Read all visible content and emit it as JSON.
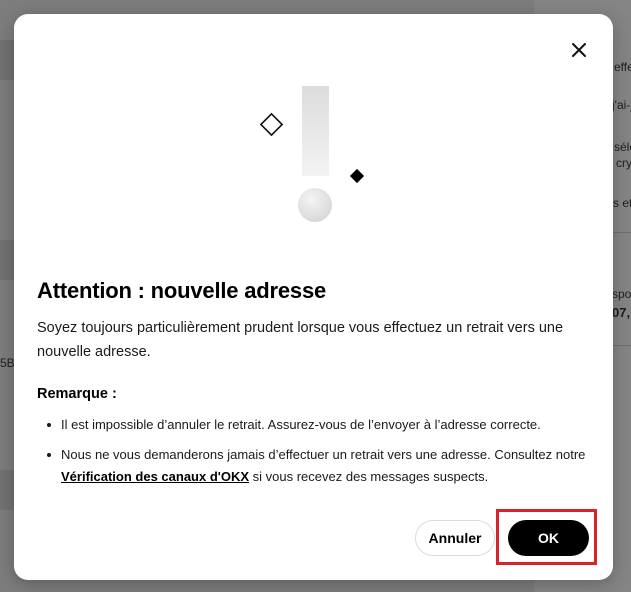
{
  "background": {
    "snippets": [
      "effe",
      "j'ai-j",
      "séle",
      "cry",
      "s et",
      "spo",
      "07,",
      "5B"
    ]
  },
  "modal": {
    "close_icon": "close-icon",
    "illustration_icon": "exclamation-warning-icon",
    "title": "Attention : nouvelle adresse",
    "description": "Soyez toujours particulièrement prudent lorsque vous effectuez un retrait vers une nouvelle adresse.",
    "note_label": "Remarque :",
    "notes": {
      "item1": "Il est impossible d’annuler le retrait. Assurez-vous de l’envoyer à l’adresse correcte.",
      "item2_before": "Nous ne vous demanderons jamais d’effectuer un retrait vers une adresse. Consultez notre ",
      "item2_link": "Vérification des canaux d'OKX",
      "item2_after": " si vous recevez des messages suspects."
    },
    "cancel_label": "Annuler",
    "ok_label": "OK"
  },
  "colors": {
    "highlight": "#d8222e",
    "primary_button": "#000000",
    "overlay": "#7d7d7d"
  }
}
